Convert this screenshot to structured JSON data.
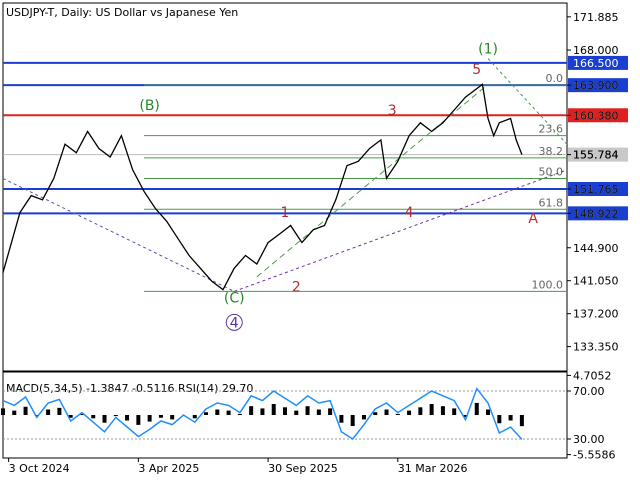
{
  "chart_data": {
    "type": "line",
    "title": "USDJPY-T, Daily:  US Dollar vs Japanese Yen",
    "price_axis": {
      "ticks": [
        "171.885",
        "168.000",
        "163.900",
        "160.380",
        "155.784",
        "151.765",
        "148.922",
        "144.900",
        "141.050",
        "137.200",
        "133.350"
      ],
      "min": 130.5,
      "max": 173.5
    },
    "time_axis": {
      "labels": [
        "3 Oct 2024",
        "3 Apr 2025",
        "30 Sep 2025",
        "31 Mar 2026"
      ]
    },
    "levels": [
      {
        "value": 166.5,
        "label": "166.500",
        "color": "#1a3fd0"
      },
      {
        "value": 163.9,
        "label": "163.900",
        "color": "#1a3fd0"
      },
      {
        "value": 160.38,
        "label": "160.380",
        "color": "#e02020"
      },
      {
        "value": 151.765,
        "label": "151.765",
        "color": "#1a3fd0"
      },
      {
        "value": 148.922,
        "label": "148.922",
        "color": "#1a3fd0"
      }
    ],
    "current_price": {
      "value": 155.784,
      "label": "155.784"
    },
    "fibonacci": [
      {
        "label": "0.0",
        "value": 163.9
      },
      {
        "label": "23.6",
        "value": 158.0
      },
      {
        "label": "38.2",
        "value": 155.4
      },
      {
        "label": "50.0",
        "value": 153.0
      },
      {
        "label": "61.8",
        "value": 149.4
      },
      {
        "label": "100.0",
        "value": 139.8
      }
    ],
    "wave_labels": [
      {
        "text": "(B)",
        "x": 0.26,
        "y": 161.0,
        "color": "#2a8a2a"
      },
      {
        "text": "(C)",
        "x": 0.41,
        "y": 138.5,
        "color": "#2a8a2a"
      },
      {
        "text": "4",
        "x": 0.41,
        "y": 135.6,
        "color": "#6030a0",
        "circle": true
      },
      {
        "text": "1",
        "x": 0.5,
        "y": 148.5,
        "color": "#b03030"
      },
      {
        "text": "2",
        "x": 0.52,
        "y": 139.8,
        "color": "#b03030"
      },
      {
        "text": "3",
        "x": 0.69,
        "y": 160.4,
        "color": "#b03030"
      },
      {
        "text": "4",
        "x": 0.72,
        "y": 148.5,
        "color": "#b03030"
      },
      {
        "text": "(1)",
        "x": 0.86,
        "y": 167.6,
        "color": "#2a8a2a"
      },
      {
        "text": "5",
        "x": 0.84,
        "y": 165.2,
        "color": "#b03030"
      },
      {
        "text": "A",
        "x": 0.94,
        "y": 147.8,
        "color": "#b03030"
      }
    ],
    "series": [
      {
        "name": "USDJPY close",
        "points": [
          [
            0.0,
            142.0
          ],
          [
            0.03,
            149.0
          ],
          [
            0.05,
            151.0
          ],
          [
            0.07,
            150.5
          ],
          [
            0.09,
            153.0
          ],
          [
            0.11,
            157.0
          ],
          [
            0.13,
            156.0
          ],
          [
            0.15,
            158.5
          ],
          [
            0.17,
            156.5
          ],
          [
            0.19,
            155.5
          ],
          [
            0.21,
            158.0
          ],
          [
            0.23,
            154.0
          ],
          [
            0.25,
            151.5
          ],
          [
            0.27,
            149.5
          ],
          [
            0.29,
            148.0
          ],
          [
            0.31,
            146.0
          ],
          [
            0.33,
            144.0
          ],
          [
            0.35,
            142.5
          ],
          [
            0.37,
            141.0
          ],
          [
            0.39,
            140.0
          ],
          [
            0.41,
            142.5
          ],
          [
            0.43,
            144.0
          ],
          [
            0.45,
            143.0
          ],
          [
            0.47,
            145.5
          ],
          [
            0.49,
            146.5
          ],
          [
            0.51,
            147.5
          ],
          [
            0.53,
            145.5
          ],
          [
            0.55,
            147.0
          ],
          [
            0.57,
            147.5
          ],
          [
            0.59,
            150.5
          ],
          [
            0.61,
            154.5
          ],
          [
            0.63,
            155.0
          ],
          [
            0.65,
            156.5
          ],
          [
            0.67,
            157.5
          ],
          [
            0.68,
            153.0
          ],
          [
            0.7,
            155.0
          ],
          [
            0.72,
            158.0
          ],
          [
            0.74,
            159.5
          ],
          [
            0.76,
            158.5
          ],
          [
            0.78,
            159.5
          ],
          [
            0.8,
            161.0
          ],
          [
            0.82,
            162.5
          ],
          [
            0.84,
            163.5
          ],
          [
            0.85,
            164.0
          ],
          [
            0.86,
            160.0
          ],
          [
            0.87,
            158.0
          ],
          [
            0.88,
            159.5
          ],
          [
            0.9,
            160.0
          ],
          [
            0.91,
            157.5
          ],
          [
            0.92,
            155.784
          ]
        ]
      }
    ],
    "indicator": {
      "title": "MACD(5,34,5) -1.3847 -0.5116 RSI(14) 29.70",
      "ticks": [
        "4.7052",
        "70.00",
        "30.00",
        "-5.5586"
      ],
      "rsi_points": [
        [
          0.0,
          62
        ],
        [
          0.02,
          58
        ],
        [
          0.04,
          65
        ],
        [
          0.06,
          48
        ],
        [
          0.08,
          60
        ],
        [
          0.1,
          63
        ],
        [
          0.12,
          45
        ],
        [
          0.14,
          52
        ],
        [
          0.16,
          44
        ],
        [
          0.18,
          36
        ],
        [
          0.2,
          48
        ],
        [
          0.22,
          40
        ],
        [
          0.24,
          32
        ],
        [
          0.26,
          38
        ],
        [
          0.28,
          45
        ],
        [
          0.3,
          42
        ],
        [
          0.32,
          50
        ],
        [
          0.34,
          44
        ],
        [
          0.36,
          55
        ],
        [
          0.38,
          60
        ],
        [
          0.4,
          58
        ],
        [
          0.42,
          52
        ],
        [
          0.44,
          66
        ],
        [
          0.46,
          62
        ],
        [
          0.48,
          70
        ],
        [
          0.5,
          64
        ],
        [
          0.52,
          58
        ],
        [
          0.54,
          66
        ],
        [
          0.56,
          60
        ],
        [
          0.58,
          62
        ],
        [
          0.6,
          36
        ],
        [
          0.62,
          30
        ],
        [
          0.64,
          42
        ],
        [
          0.66,
          55
        ],
        [
          0.68,
          60
        ],
        [
          0.7,
          52
        ],
        [
          0.72,
          58
        ],
        [
          0.74,
          64
        ],
        [
          0.76,
          70
        ],
        [
          0.78,
          66
        ],
        [
          0.8,
          62
        ],
        [
          0.82,
          46
        ],
        [
          0.84,
          72
        ],
        [
          0.86,
          60
        ],
        [
          0.88,
          35
        ],
        [
          0.9,
          40
        ],
        [
          0.92,
          29.7
        ]
      ]
    }
  }
}
